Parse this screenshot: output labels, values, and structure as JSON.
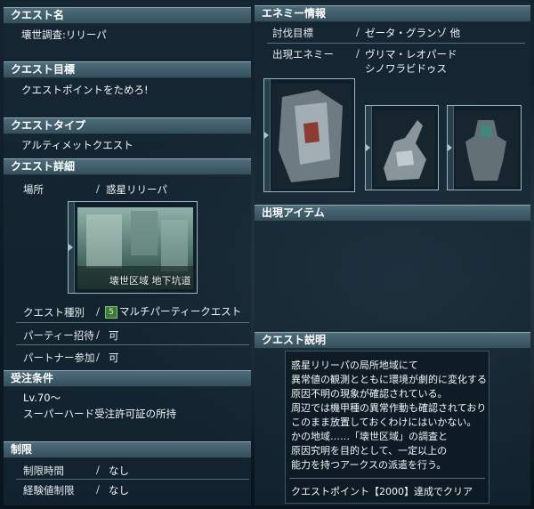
{
  "left": {
    "quest_name_header": "クエスト名",
    "quest_name": "壊世調査:リリーパ",
    "quest_goal_header": "クエスト目標",
    "quest_goal": "クエストポイントをためろ!",
    "quest_type_header": "クエストタイプ",
    "quest_type": "アルティメットクエスト",
    "quest_detail_header": "クエスト詳細",
    "location_label": "場所",
    "location_value": "惑星リリーパ",
    "area_caption": "壊世区域 地下坑道",
    "quest_kind_label": "クエスト種別",
    "quest_kind_icon": "5",
    "quest_kind_value": "マルチパーティークエスト",
    "party_invite_label": "パーティー招待",
    "party_invite_value": "可",
    "partner_label": "パートナー参加",
    "partner_value": "可",
    "conditions_header": "受注条件",
    "condition_level": "Lv.70～",
    "condition_permit": "スーパーハード受注許可証の所持",
    "limits_header": "制限",
    "time_limit_label": "制限時間",
    "time_limit_value": "なし",
    "exp_limit_label": "経験値制限",
    "exp_limit_value": "なし",
    "slash": "/"
  },
  "right": {
    "enemy_header": "エネミー情報",
    "target_label": "討伐目標",
    "target_value": "ゼータ・グランゾ 他",
    "enemies_label": "出現エネミー",
    "enemy_1": "ヴリマ・レオパード",
    "enemy_2": "シノワラビドゥス",
    "items_header": "出現アイテム",
    "desc_header": "クエスト説明",
    "desc_lines": [
      "惑星リリーパの局所地域にて",
      "異常値の観測とともに環境が劇的に変化する",
      "原因不明の現象が確認されている。",
      "周辺では機甲種の異常作動も確認されており",
      "このまま放置しておくわけにはいかない。",
      "かの地域……「壊世区域」の調査と",
      "原因究明を目的として、一定以上の",
      "能力を持つアークスの派遣を行う。"
    ],
    "clear_condition": "クエストポイント【2000】達成でクリア",
    "slash": "/"
  },
  "colors": {
    "header_bg": "#3f5b69",
    "panel_bg": "#162834",
    "icon_green": "#3f7a3a"
  },
  "icons": {
    "quest_kind": "multiparty-quest-icon",
    "thumb_tab": "triangle-right-icon"
  }
}
